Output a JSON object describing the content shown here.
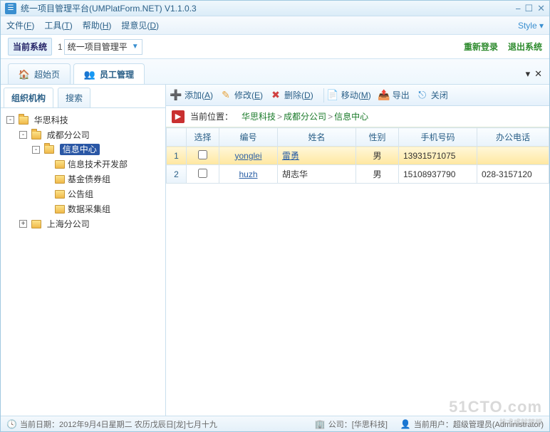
{
  "title": "统一项目管理平台(UMPlatForm.NET) V1.1.0.3",
  "menu": {
    "file": "文件(F)",
    "tools": "工具(T)",
    "help": "帮助(H)",
    "feedback": "提意见(D)",
    "style": "Style ▾"
  },
  "subhdr": {
    "label": "当前系统",
    "num": "1",
    "current": "统一项目管理平",
    "relogin": "重新登录",
    "exit": "退出系统"
  },
  "tabs": {
    "start": "超始页",
    "employee": "员工管理"
  },
  "left_tabs": {
    "org": "组织机构",
    "search": "搜索"
  },
  "tree": {
    "root": "华思科技",
    "n1": "成都分公司",
    "n1a": "信息中心",
    "n1a1": "信息技术开发部",
    "n1a2": "基金债券组",
    "n1a3": "公告组",
    "n1a4": "数据采集组",
    "n2": "上海分公司"
  },
  "toolbar": {
    "add": "添加(A)",
    "edit": "修改(E)",
    "del": "删除(D)",
    "move": "移动(M)",
    "export": "导出",
    "close": "关闭"
  },
  "breadcrumb": {
    "label": "当前位置：",
    "a": "华思科技",
    "b": "成都分公司",
    "c": "信息中心"
  },
  "columns": {
    "sel": "选择",
    "code": "编号",
    "name": "姓名",
    "gender": "性别",
    "mobile": "手机号码",
    "office": "办公电话"
  },
  "rows": [
    {
      "idx": "1",
      "code": "yonglei",
      "name": "雷勇",
      "gender": "男",
      "mobile": "13931571075",
      "office": ""
    },
    {
      "idx": "2",
      "code": "huzh",
      "name": "胡志华",
      "gender": "男",
      "mobile": "15108937790",
      "office": "028-3157120"
    }
  ],
  "status": {
    "date_label": "当前日期：",
    "date": "2012年9月4日星期二 农历戊辰日[龙]七月十九",
    "company_label": "公司：",
    "company": "[华思科技]",
    "user_label": "当前用户：",
    "user": "超级管理员(Administrator)"
  },
  "watermark": {
    "main": "51CTO.com",
    "sub": "技术成就梦想"
  }
}
